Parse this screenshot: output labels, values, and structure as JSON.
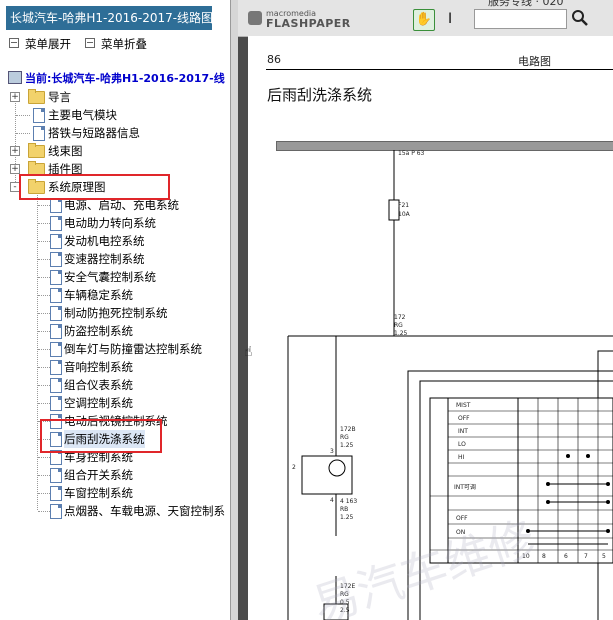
{
  "left_panel": {
    "title": "长城汽车-哈弗H1-2016-2017-线路图",
    "expand_all_label": "菜单展开",
    "collapse_all_label": "菜单折叠",
    "current_path": "当前:长城汽车-哈弗H1-2016-2017-线",
    "tree": {
      "root_items": [
        {
          "label": "导言",
          "type": "folder",
          "expander": "+"
        },
        {
          "label": "主要电气模块",
          "type": "doc"
        },
        {
          "label": "搭铁与短路器信息",
          "type": "doc"
        },
        {
          "label": "线束图",
          "type": "folder",
          "expander": "+"
        },
        {
          "label": "插件图",
          "type": "folder",
          "expander": "+"
        },
        {
          "label": "系统原理图",
          "type": "folder",
          "expander": "-"
        }
      ],
      "system_children": [
        "电源、启动、充电系统",
        "电动助力转向系统",
        "发动机电控系统",
        "变速器控制系统",
        "安全气囊控制系统",
        "车辆稳定系统",
        "制动防抱死控制系统",
        "防盗控制系统",
        "倒车灯与防撞雷达控制系统",
        "音响控制系统",
        "组合仪表系统",
        "空调控制系统",
        "电动后视镜控制系统",
        "后雨刮洗涤系统",
        "车身控制系统",
        "组合开关系统",
        "车窗控制系统",
        "点烟器、车载电源、天窗控制系"
      ],
      "selected": "后雨刮洗涤系统"
    }
  },
  "viewer": {
    "top_text": "服务专线 · 020",
    "logo_small": "macromedia",
    "logo_big": "FLASHPAPER",
    "page": {
      "page_number": "86",
      "header": "电路图",
      "title": "后雨刮洗涤系统",
      "diagram_labels": {
        "ignition": "15a P 63",
        "fuse_id": "F21",
        "fuse_amp": "10A",
        "w1_num": "172",
        "w1_color": "RG",
        "w1_size": "1.25",
        "w2_num": "172B",
        "w2_color": "RG",
        "w2_size": "1.25",
        "pin3": "3",
        "pin2": "2",
        "pin4": "4",
        "w3_num": "4 163",
        "w3_color": "RB",
        "w3_size": "1.25",
        "w4_num": "172E",
        "w4_color": "RG",
        "w4_size": "0.5",
        "w4_num2": "2.5",
        "row_mist": "MIST",
        "row_off": "OFF",
        "row_int": "INT",
        "row_lo": "LO",
        "row_hi": "HI",
        "row_int_v": "INT可调",
        "row_off2": "OFF",
        "row_on": "ON",
        "row_num": "10",
        "row_num2": "8",
        "row_num3": "6",
        "row_num4": "7",
        "row_num5": "5"
      }
    },
    "watermark": "易汽车维修"
  },
  "colors": {
    "title_bar": "#2e6e97",
    "highlight_box": "#e0262a",
    "current_path": "#0000cc"
  }
}
